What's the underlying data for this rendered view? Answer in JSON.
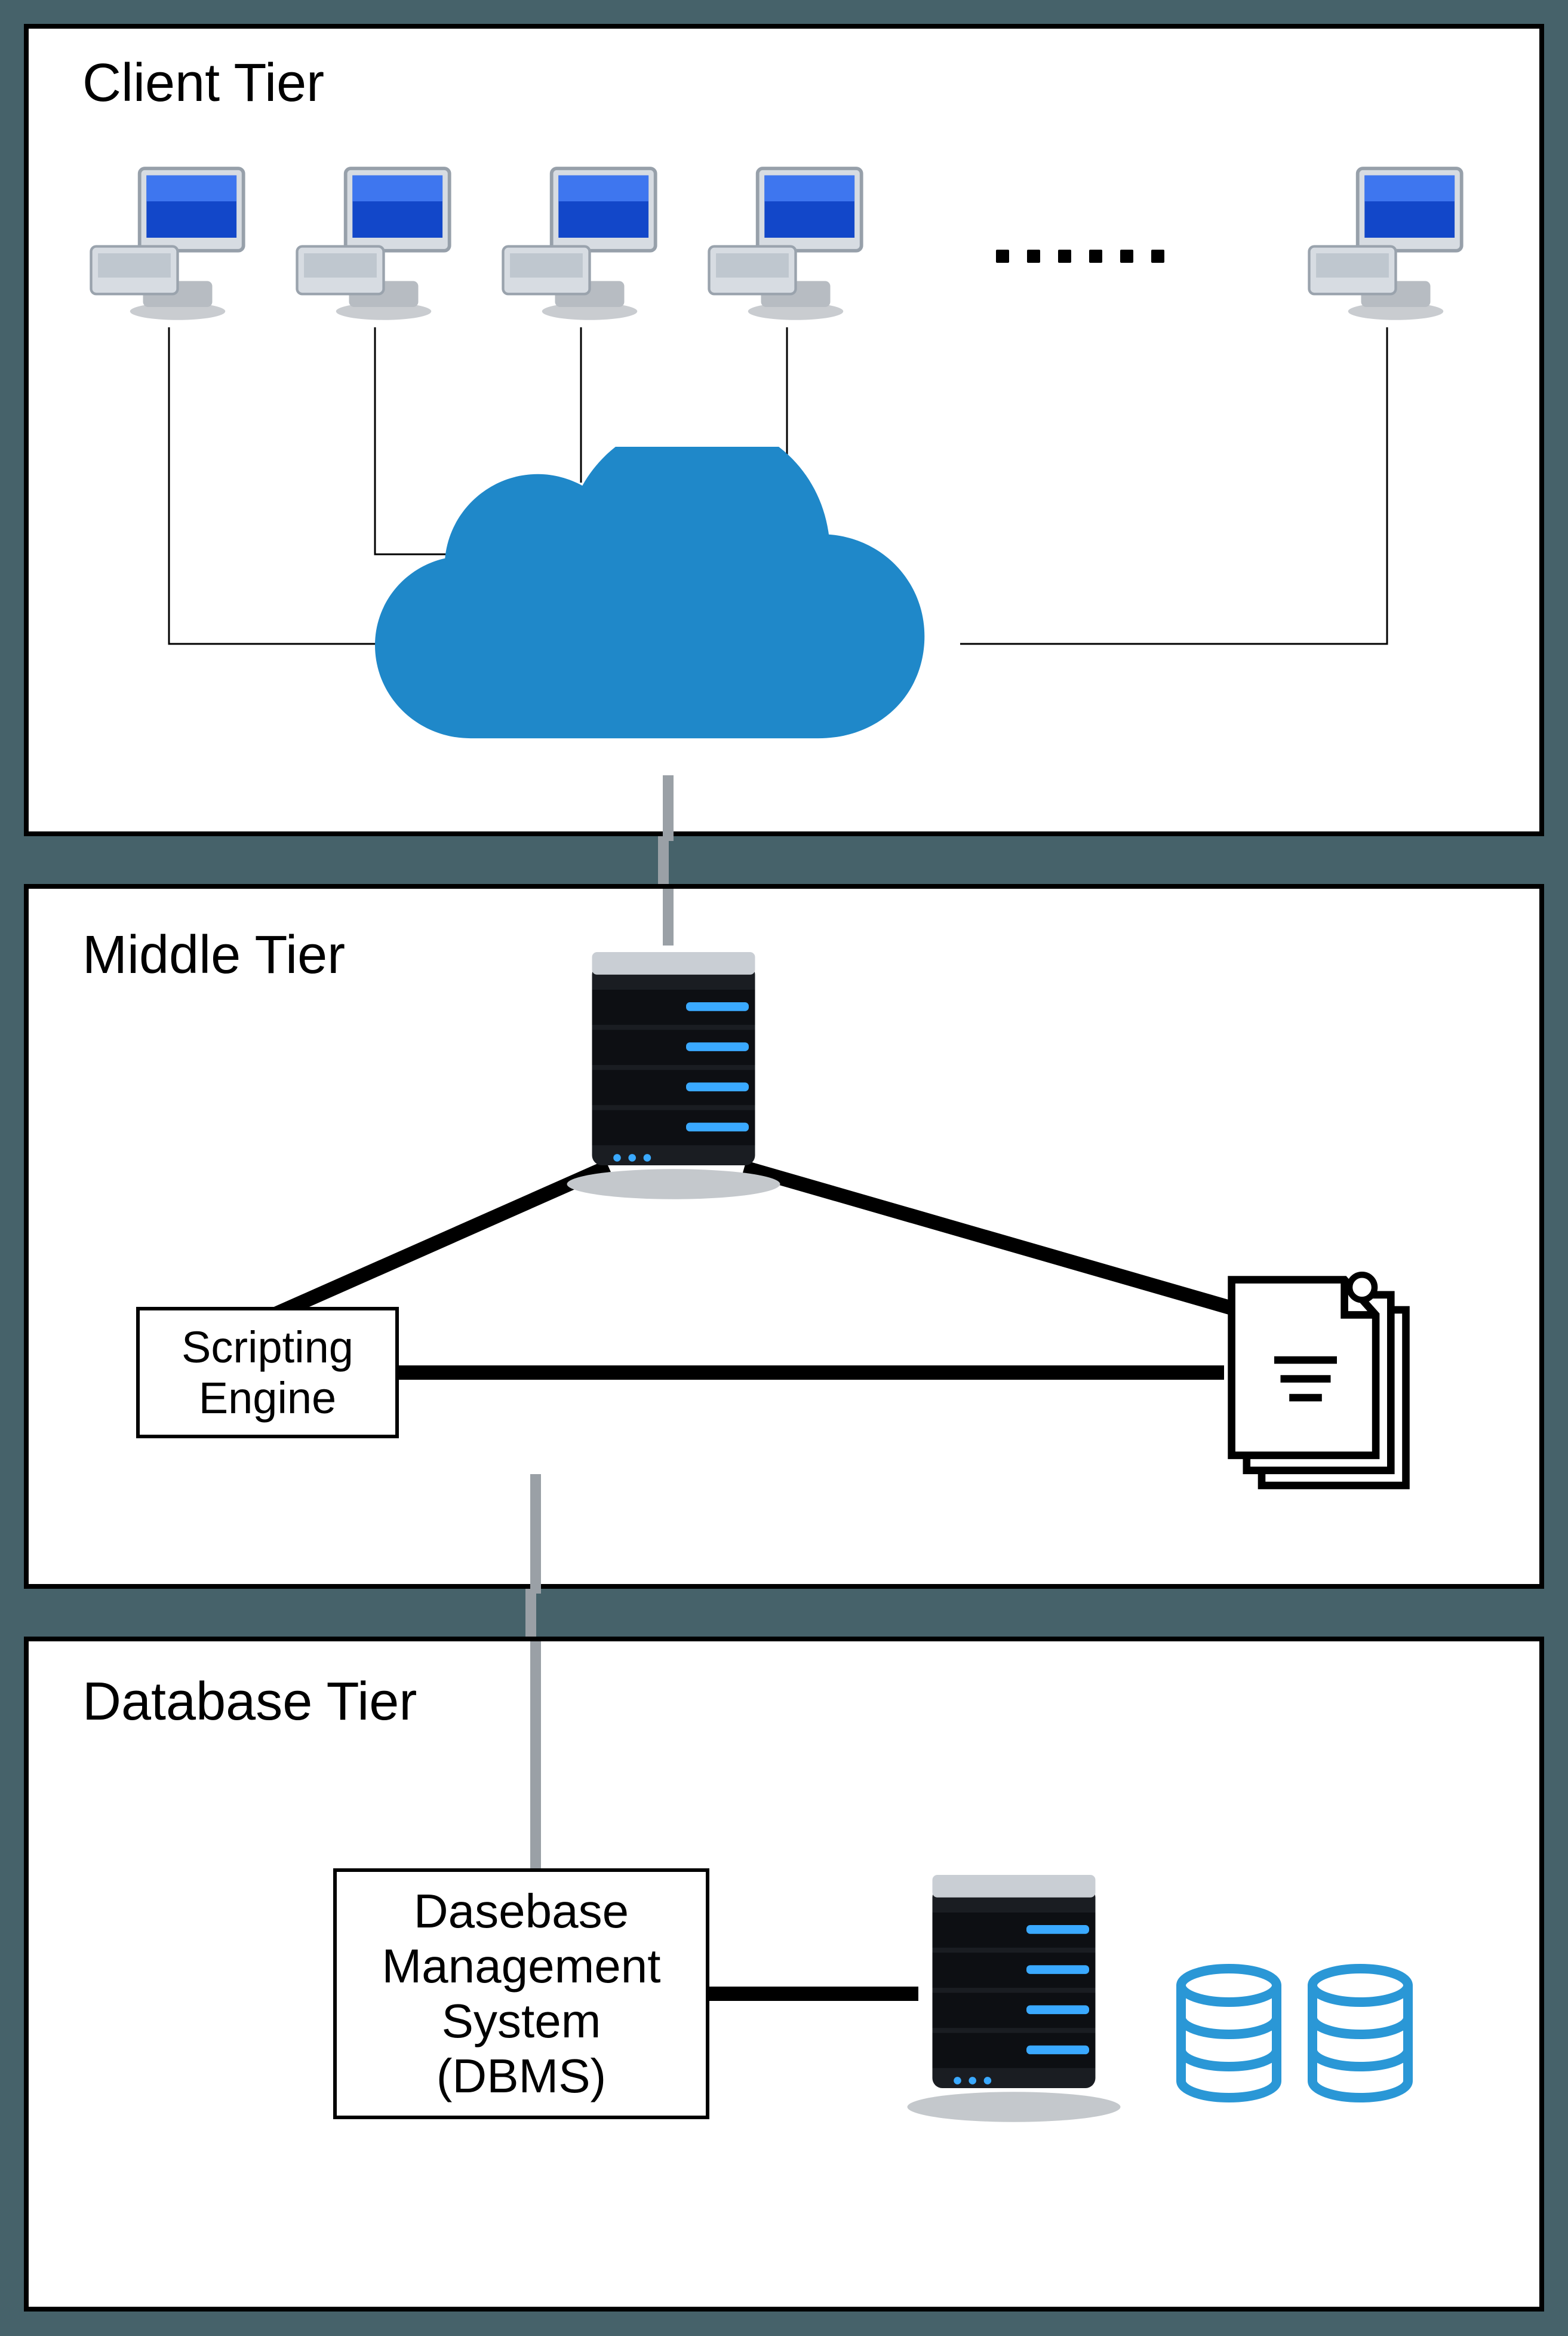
{
  "tiers": {
    "client": {
      "title": "Client Tier"
    },
    "middle": {
      "title": "Middle Tier",
      "scripting_label": "Scripting\nEngine"
    },
    "database": {
      "title": "Database Tier",
      "dbms_label": "Dasebase\nManagement\nSystem\n(DBMS)"
    }
  }
}
